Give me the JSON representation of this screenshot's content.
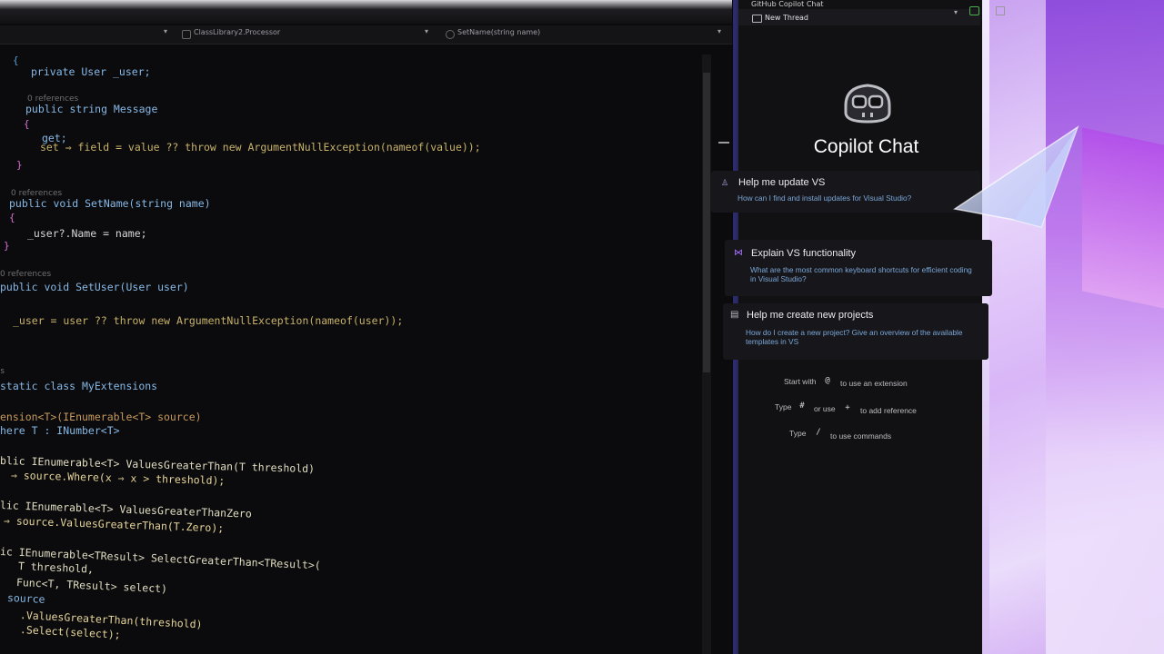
{
  "editor": {
    "nav": {
      "project": "ClassLibrary2.Processor",
      "member": "SetName(string name)"
    },
    "code": [
      "{",
      "private User _user;",
      "0 references",
      "public string Message",
      "{",
      "get;",
      "set ⇒ field = value ?? throw new ArgumentNullException(nameof(value));",
      "}",
      "0 references",
      "public void SetName(string name)",
      "{",
      "_user?.Name = name;",
      "}",
      "0 references",
      "public void SetUser(User user)",
      "_user = user ?? throw new ArgumentNullException(nameof(user));",
      "s",
      "static class MyExtensions",
      "ension<T>(IEnumerable<T> source)",
      "here T : INumber<T>",
      "blic IEnumerable<T> ValuesGreaterThan(T threshold)",
      "⇒ source.Where(x ⇒ x > threshold);",
      "lic IEnumerable<T> ValuesGreaterThanZero",
      "⇒ source.ValuesGreaterThan(T.Zero);",
      "ic IEnumerable<TResult> SelectGreaterThan<TResult>(",
      "T threshold,",
      "Func<T, TResult> select)",
      "source",
      ".ValuesGreaterThan(threshold)",
      ".Select(select);"
    ]
  },
  "copilot": {
    "window_title": "GitHub Copilot Chat",
    "thread_label": "New Thread",
    "heading": "Copilot Chat",
    "suggestions": [
      {
        "title": "Help me update VS",
        "subtitle": "How can I find and install updates for Visual Studio?",
        "icon": "person-icon"
      },
      {
        "title": "Explain VS functionality",
        "subtitle": "What are the most common keyboard shortcuts for efficient coding in Visual Studio?",
        "icon": "vs-logo-icon"
      },
      {
        "title": "Help me create new projects",
        "subtitle": "How do I create a new project? Give an overview of the available templates in VS",
        "icon": "template-icon"
      }
    ],
    "hints": {
      "line1_a": "Start with",
      "line1_key": "@",
      "line1_b": "to use an extension",
      "line2_a": "Type",
      "line2_key1": "#",
      "line2_mid": "or use",
      "line2_key2": "+",
      "line2_b": "to add reference",
      "line3_a": "Type",
      "line3_key": "/",
      "line3_b": "to use commands"
    }
  },
  "colors": {
    "accent_purple": "#c9a2f0",
    "code_keyword": "#569cd6",
    "code_type": "#4ec9b0",
    "link_blue": "#7aa7d8"
  }
}
